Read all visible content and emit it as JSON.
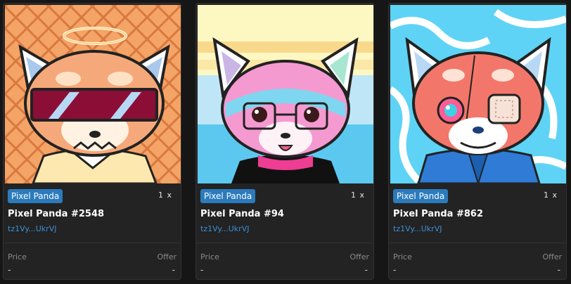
{
  "cards": [
    {
      "badge": "Pixel Panda",
      "quantity": "1 x",
      "name": "Pixel Panda #2548",
      "owner": "tz1Vy...UkrVJ",
      "price_label": "Price",
      "offer_label": "Offer",
      "price_value": "-",
      "offer_value": "-"
    },
    {
      "badge": "Pixel Panda",
      "quantity": "1 x",
      "name": "Pixel Panda #94",
      "owner": "tz1Vy...UkrVJ",
      "price_label": "Price",
      "offer_label": "Offer",
      "price_value": "-",
      "offer_value": "-"
    },
    {
      "badge": "Pixel Panda",
      "quantity": "1 x",
      "name": "Pixel Panda #862",
      "owner": "tz1Vy...UkrVJ",
      "price_label": "Price",
      "offer_label": "Offer",
      "price_value": "-",
      "offer_value": "-"
    }
  ],
  "colors": {
    "badge": "#2b7bbd",
    "link": "#3d8fd6",
    "card_bg": "#232323",
    "page_bg": "#161616"
  }
}
